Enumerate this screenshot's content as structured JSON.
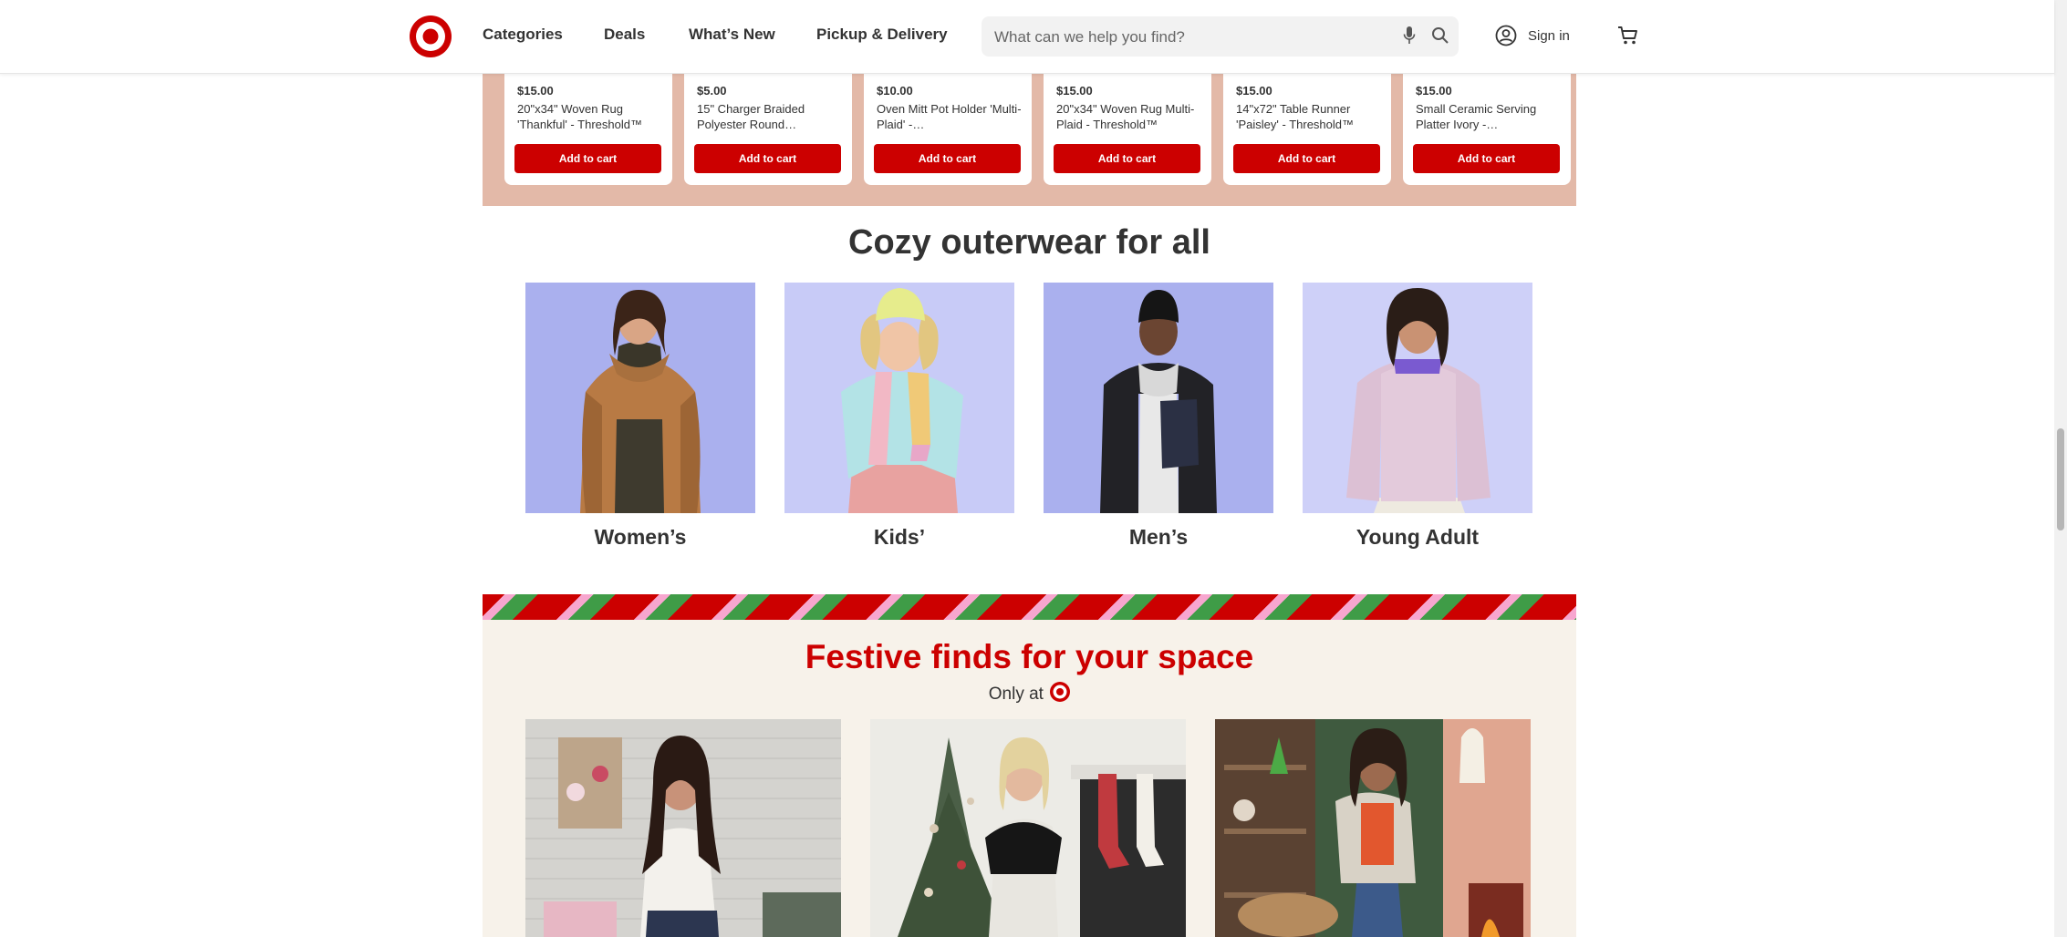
{
  "header": {
    "nav": [
      "Categories",
      "Deals",
      "What’s New",
      "Pickup & Delivery"
    ],
    "search_placeholder": "What can we help you find?",
    "sign_in": "Sign in"
  },
  "products": [
    {
      "price": "$15.00",
      "name": "20\"x34\" Woven Rug 'Thankful' - Threshold™",
      "button": "Add to cart"
    },
    {
      "price": "$5.00",
      "name": "15\" Charger Braided Polyester Round…",
      "button": "Add to cart"
    },
    {
      "price": "$10.00",
      "name": "Oven Mitt Pot Holder 'Multi-Plaid' -…",
      "button": "Add to cart"
    },
    {
      "price": "$15.00",
      "name": "20\"x34\" Woven Rug Multi-Plaid - Threshold™",
      "button": "Add to cart"
    },
    {
      "price": "$15.00",
      "name": "14\"x72\" Table Runner 'Paisley' - Threshold™",
      "button": "Add to cart"
    },
    {
      "price": "$15.00",
      "name": "Small Ceramic Serving Platter Ivory -…",
      "button": "Add to cart"
    }
  ],
  "cozy": {
    "heading": "Cozy outerwear for all",
    "categories": [
      "Women’s",
      "Kids’",
      "Men’s",
      "Young Adult"
    ]
  },
  "festive": {
    "heading": "Festive finds for your space",
    "subheading": "Only at"
  },
  "colors": {
    "brand_red": "#cc0000",
    "strip_bg": "#e3b9a8",
    "festive_bg": "#f7f2ea",
    "category_bg": "#aab0ee"
  }
}
